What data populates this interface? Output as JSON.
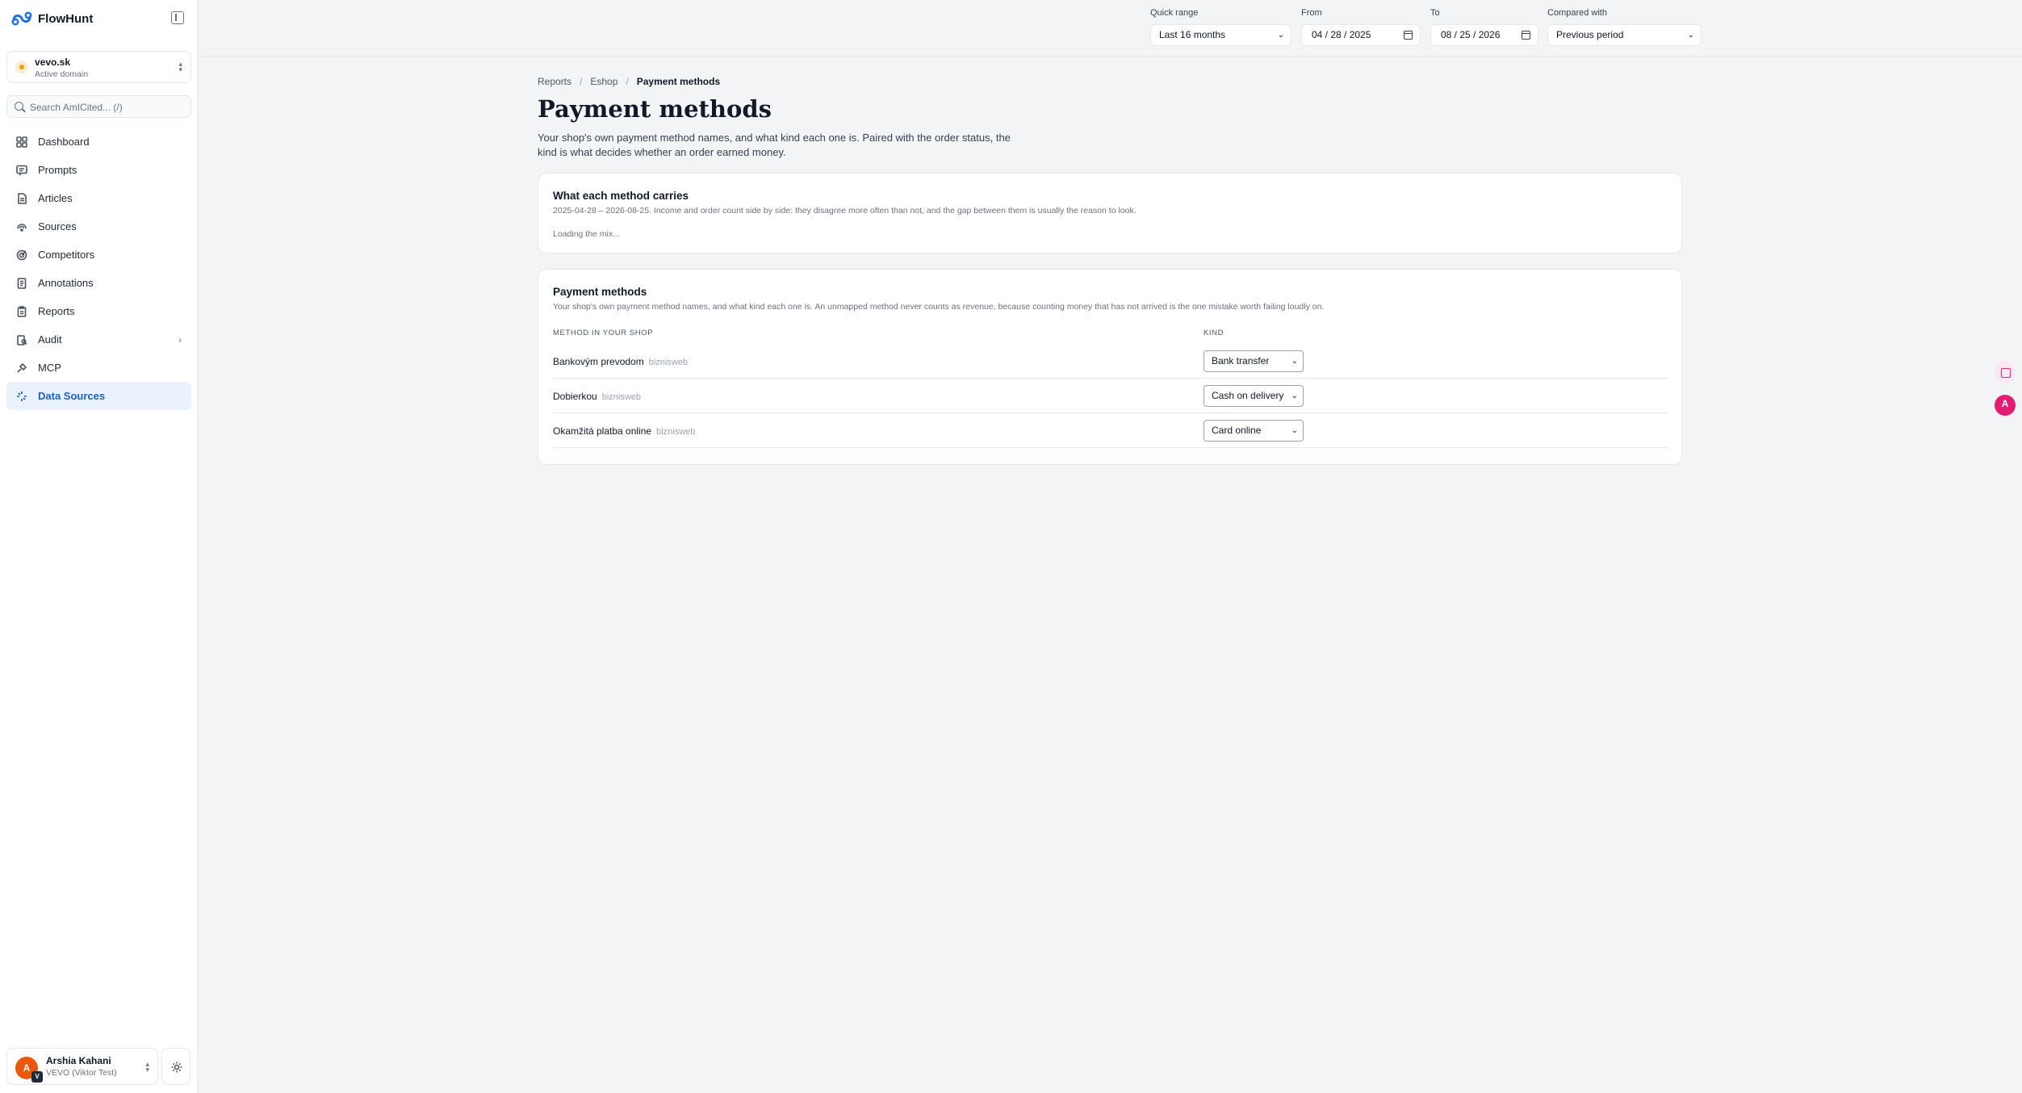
{
  "brand": {
    "name": "FlowHunt"
  },
  "domain": {
    "name": "vevo.sk",
    "status": "Active domain"
  },
  "search": {
    "placeholder": "Search AmICited... (/)"
  },
  "nav": [
    {
      "label": "Dashboard",
      "icon": "dashboard-icon"
    },
    {
      "label": "Prompts",
      "icon": "prompts-icon"
    },
    {
      "label": "Articles",
      "icon": "articles-icon"
    },
    {
      "label": "Sources",
      "icon": "sources-icon"
    },
    {
      "label": "Competitors",
      "icon": "competitors-icon"
    },
    {
      "label": "Annotations",
      "icon": "annotations-icon"
    },
    {
      "label": "Reports",
      "icon": "reports-icon"
    },
    {
      "label": "Audit",
      "icon": "audit-icon"
    },
    {
      "label": "MCP",
      "icon": "mcp-icon"
    },
    {
      "label": "Data Sources",
      "icon": "data-sources-icon",
      "active": true
    }
  ],
  "user": {
    "initial": "A",
    "badge": "V",
    "name": "Arshia Kahani",
    "org": "VEVO (Viktor Test)"
  },
  "filters": {
    "quick_range_label": "Quick range",
    "quick_range_value": "Last 16 months",
    "from_label": "From",
    "from_value": "04 / 28 / 2025",
    "to_label": "To",
    "to_value": "08 / 25 / 2026",
    "compared_label": "Compared with",
    "compared_value": "Previous period"
  },
  "breadcrumb": [
    "Reports",
    "Eshop",
    "Payment methods"
  ],
  "page": {
    "title": "Payment methods",
    "description": "Your shop's own payment method names, and what kind each one is. Paired with the order status, the kind is what decides whether an order earned money."
  },
  "carries_card": {
    "title": "What each method carries",
    "subtitle": "2025-04-28 – 2026-08-25. Income and order count side by side: they disagree more often than not, and the gap between them is usually the reason to look.",
    "loading": "Loading the mix..."
  },
  "methods_card": {
    "title": "Payment methods",
    "subtitle": "Your shop's own payment method names, and what kind each one is. An unmapped method never counts as revenue, because counting money that has not arrived is the one mistake worth failing loudly on.",
    "col_method": "METHOD IN YOUR SHOP",
    "col_kind": "KIND",
    "rows": [
      {
        "name": "Bankovým prevodom",
        "source": "biznisweb",
        "kind": "Bank transfer"
      },
      {
        "name": "Dobierkou",
        "source": "biznisweb",
        "kind": "Cash on delivery"
      },
      {
        "name": "Okamžitá platba online",
        "source": "biznisweb",
        "kind": "Card online"
      }
    ]
  },
  "colors": {
    "accent": "#1d5fc4",
    "active_bg": "#eaf2fd",
    "avatar": "#ea580c"
  }
}
